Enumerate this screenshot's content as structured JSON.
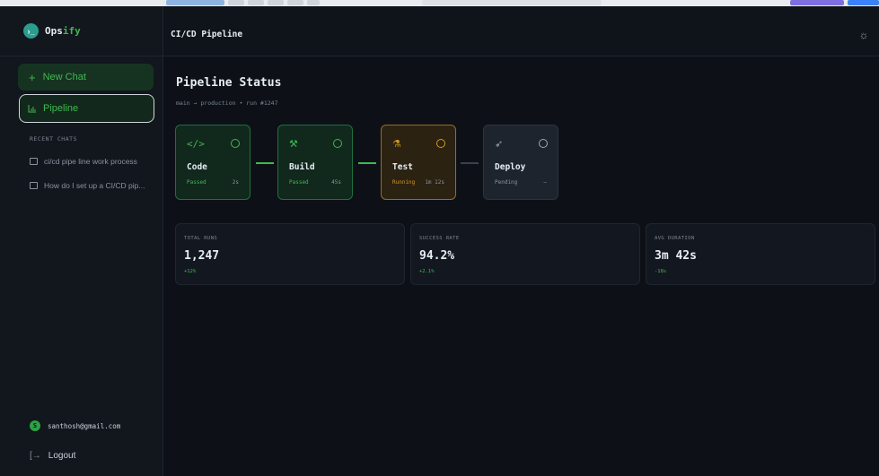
{
  "app": {
    "name_prefix": "Ops",
    "name_suffix": "ify",
    "logo_glyph": "›_"
  },
  "sidebar": {
    "new_chat_label": "New Chat",
    "pipeline_label": "Pipeline",
    "recent_label": "RECENT CHATS",
    "recent_chats": [
      "ci/cd pipe line work process",
      "How do I set up a CI/CD pip..."
    ],
    "user_email": "santhosh@gmail.com",
    "user_initial": "S",
    "logout_label": "Logout"
  },
  "header": {
    "title": "CI/CD Pipeline",
    "theme_icon": "sun-icon"
  },
  "main": {
    "title": "Pipeline Status",
    "subtitle": "main → production • run #1247",
    "stages": [
      {
        "name": "Code",
        "status": "Passed",
        "duration": "2s",
        "icon": "code-icon",
        "state": "passed"
      },
      {
        "name": "Build",
        "status": "Passed",
        "duration": "45s",
        "icon": "hammer-icon",
        "state": "passed"
      },
      {
        "name": "Test",
        "status": "Running",
        "duration": "1m 12s",
        "icon": "flask-icon",
        "state": "running"
      },
      {
        "name": "Deploy",
        "status": "Pending",
        "duration": "—",
        "icon": "rocket-icon",
        "state": "pending"
      }
    ],
    "stats": [
      {
        "label": "TOTAL RUNS",
        "value": "1,247",
        "delta": "+12%"
      },
      {
        "label": "SUCCESS RATE",
        "value": "94.2%",
        "delta": "+2.1%"
      },
      {
        "label": "AVG DURATION",
        "value": "3m 42s",
        "delta": "-18s"
      }
    ]
  },
  "colors": {
    "accent_green": "#3fb950",
    "running_orange": "#d29922",
    "background": "#0d1117"
  }
}
